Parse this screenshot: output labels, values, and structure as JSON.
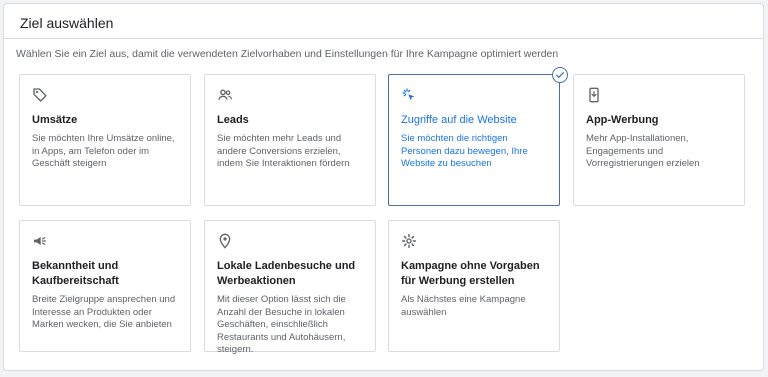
{
  "panel": {
    "title": "Ziel auswählen",
    "subtitle": "Wählen Sie ein Ziel aus, damit die verwendeten Zielvorhaben und Einstellungen für Ihre Kampagne optimiert werden"
  },
  "accent_color": "#1a73e8",
  "goals": [
    {
      "icon": "tag-icon",
      "title": "Umsätze",
      "description": "Sie möchten Ihre Umsätze online, in Apps, am Telefon oder im Geschäft steigern",
      "selected": false
    },
    {
      "icon": "people-icon",
      "title": "Leads",
      "description": "Sie möchten mehr Leads und andere Conversions erzielen, indem Sie Interaktionen fördern",
      "selected": false
    },
    {
      "icon": "cursor-click-icon",
      "title": "Zugriffe auf die Website",
      "description": "Sie möchten die richtigen Personen dazu bewegen, Ihre Website zu besuchen",
      "selected": true
    },
    {
      "icon": "phone-download-icon",
      "title": "App-Werbung",
      "description": "Mehr App-Installationen, Engagements und Vorregistrierungen erzielen",
      "selected": false
    },
    {
      "icon": "megaphone-icon",
      "title": "Bekanntheit und Kaufbereitschaft",
      "description": "Breite Zielgruppe ansprechen und Interesse an Produkten oder Marken wecken, die Sie anbieten",
      "selected": false
    },
    {
      "icon": "location-pin-icon",
      "title": "Lokale Ladenbesuche und Werbeaktionen",
      "description": "Mit dieser Option lässt sich die Anzahl der Besuche in lokalen Geschäften, einschließlich Restaurants und Autohäusern, steigern.",
      "selected": false
    },
    {
      "icon": "gear-icon",
      "title": "Kampagne ohne Vorgaben für Werbung erstellen",
      "description": "Als Nächstes eine Kampagne auswählen",
      "selected": false
    }
  ]
}
